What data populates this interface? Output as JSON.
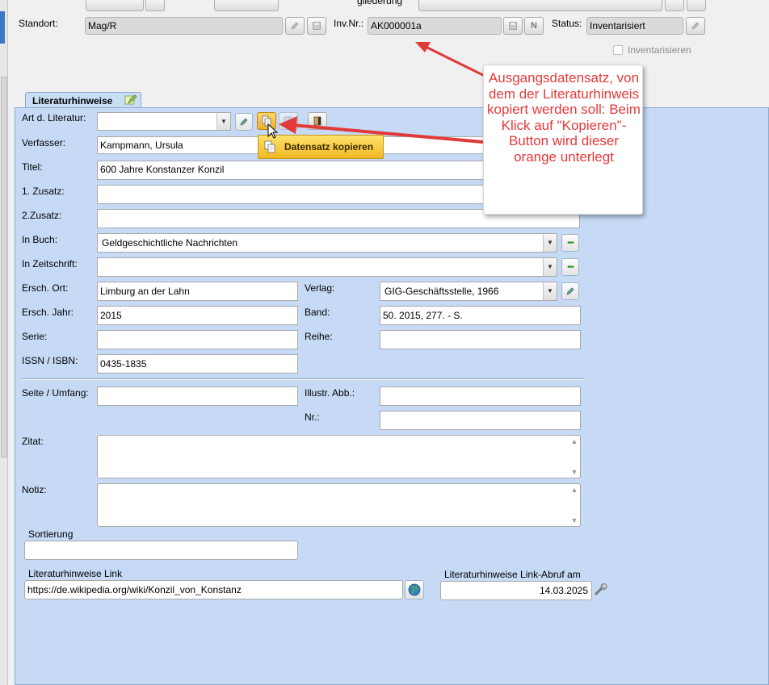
{
  "header": {
    "partial_label": "gliederung",
    "standort_label": "Standort:",
    "standort_value": "Mag/R",
    "invnr_label": "Inv.Nr.:",
    "invnr_value": "AK000001a",
    "n_button": "N",
    "status_label": "Status:",
    "status_value": "Inventarisiert",
    "inventarisieren_label": "Inventarisieren"
  },
  "tab": {
    "label": "Literaturhinweise"
  },
  "form": {
    "art_label": "Art d. Literatur:",
    "art_value": "",
    "verfasser_label": "Verfasser:",
    "verfasser_value": "Kampmann, Ursula",
    "titel_label": "Titel:",
    "titel_value": "600 Jahre Konstanzer Konzil",
    "zusatz1_label": "1. Zusatz:",
    "zusatz1_value": "",
    "zusatz2_label": "2.Zusatz:",
    "zusatz2_value": "",
    "inbuch_label": "In Buch:",
    "inbuch_value": "Geldgeschichtliche Nachrichten",
    "inzeitschrift_label": "In Zeitschrift:",
    "inzeitschrift_value": "",
    "erschort_label": "Ersch. Ort:",
    "erschort_value": "Limburg an der Lahn",
    "verlag_label": "Verlag:",
    "verlag_value": "GIG-Geschäftsstelle, 1966",
    "erschjahr_label": "Ersch. Jahr:",
    "erschjahr_value": "2015",
    "band_label": "Band:",
    "band_value": "50. 2015, 277. - S.",
    "serie_label": "Serie:",
    "serie_value": "",
    "reihe_label": "Reihe:",
    "reihe_value": "",
    "issn_label": "ISSN / ISBN:",
    "issn_value": "0435-1835",
    "seite_label": "Seite / Umfang:",
    "seite_value": "",
    "illustr_label": "Illustr. Abb.:",
    "illustr_value": "",
    "nr_label": "Nr.:",
    "nr_value": "",
    "zitat_label": "Zitat:",
    "notiz_label": "Notiz:",
    "sortierung_label": "Sortierung",
    "sortierung_value": "",
    "link_label": "Literaturhinweise Link",
    "link_value": "https://de.wikipedia.org/wiki/Konzil_von_Konstanz",
    "abruf_label": "Literaturhinweise Link-Abruf am",
    "abruf_value": "14.03.2025",
    "dots": "•••"
  },
  "tooltip": {
    "text": "Datensatz kopieren"
  },
  "callout": {
    "text": "Ausgangsdatensatz, von dem der Literaturhinweis kopiert werden soll: Beim Klick auf \"Kopieren\"-Button wird dieser orange unterlegt"
  },
  "colors": {
    "panel": "#c6daf6",
    "tooltip": "#f5c431",
    "callout_text": "#e63939",
    "arrow": "#e03a3a"
  }
}
